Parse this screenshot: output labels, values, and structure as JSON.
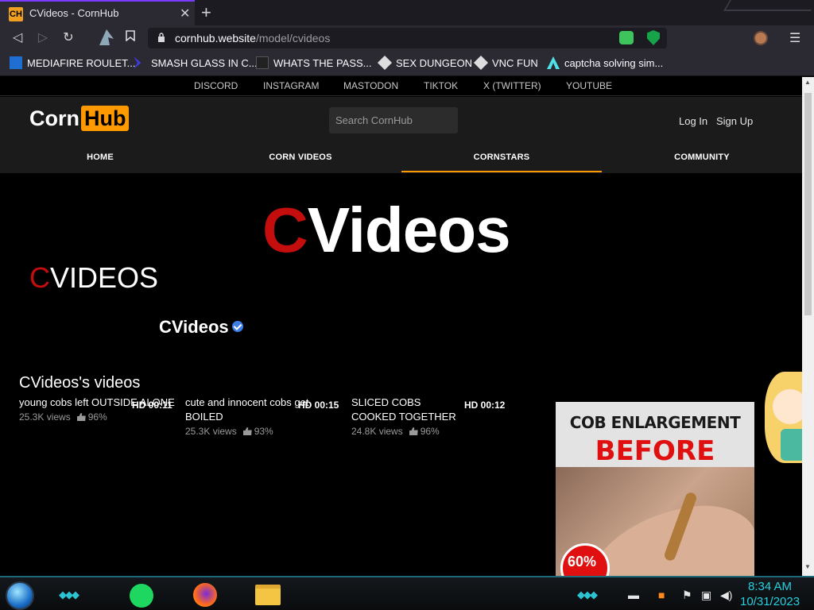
{
  "browser": {
    "tab_favicon": "CH",
    "tab_title": "CVideos - CornHub",
    "tab_close": "✕",
    "new_tab": "+",
    "url_host": "cornhub.website",
    "url_path": "/model/cvideos",
    "bookmarks": [
      {
        "label": "MEDIAFIRE ROULET...",
        "icon": "mediafire-icon",
        "color": "#1f6fd1"
      },
      {
        "label": "SMASH GLASS IN C...",
        "icon": "chevron-logo-icon",
        "color": "#3b3bd6"
      },
      {
        "label": "WHATS THE PASS...",
        "icon": "lock-icon",
        "color": "#222222"
      },
      {
        "label": "SEX DUNGEON",
        "icon": "cube-icon",
        "color": "#dddddd"
      },
      {
        "label": "VNC FUN",
        "icon": "cube-icon",
        "color": "#dddddd"
      },
      {
        "label": "captcha solving sim...",
        "icon": "caret-logo-icon",
        "color": "#4fe0e8"
      }
    ]
  },
  "social": [
    "DISCORD",
    "INSTAGRAM",
    "MASTODON",
    "TIKTOK",
    "X (TWITTER)",
    "YOUTUBE"
  ],
  "header": {
    "logo_corn": "Corn",
    "logo_hub": "Hub",
    "search_placeholder": "Search CornHub",
    "login": "Log In",
    "signup": "Sign Up",
    "nav": [
      "HOME",
      "CORN VIDEOS",
      "CORNSTARS",
      "COMMUNITY"
    ],
    "active_nav": "CORNSTARS"
  },
  "banner": {
    "title_c": "C",
    "title_rest": "Videos",
    "sub_c": "C",
    "sub_rest": "VIDEOS"
  },
  "model": {
    "name": "CVideos",
    "verified": true,
    "videos_heading": "CVideos's videos"
  },
  "videos": [
    {
      "title": "young cobs left OUTSIDE ALONE",
      "hd": "HD 00:11",
      "views": "25.3K views",
      "rating": "96%"
    },
    {
      "title": "cute and innocent cobs get BOILED",
      "hd": "HD 00:15",
      "views": "25.3K views",
      "rating": "93%"
    },
    {
      "title": "SLICED COBS COOKED TOGETHER",
      "hd": "HD 00:12",
      "views": "24.8K views",
      "rating": "96%"
    }
  ],
  "ad": {
    "line1": "COB ENLARGEMENT",
    "line2": "BEFORE",
    "badge": "60%"
  },
  "taskbar": {
    "time": "8:34 AM",
    "date": "10/31/2023"
  },
  "colors": {
    "accent": "#ff9900",
    "red": "#c40d0d",
    "clock": "#26d0e0"
  }
}
